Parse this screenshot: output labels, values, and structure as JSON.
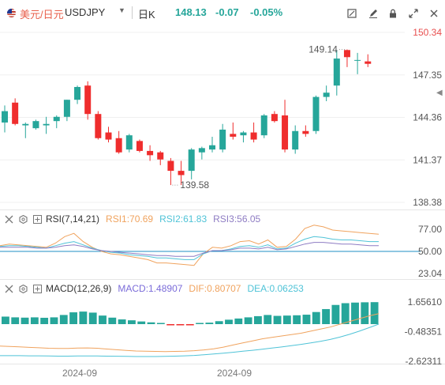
{
  "header": {
    "pair_cn": "美元/日元",
    "pair_code": "USDJPY",
    "period": "日K",
    "price": "148.13",
    "change": "-0.07",
    "change_pct": "-0.05%"
  },
  "toolbar_icons": [
    "draw-icon",
    "pen-icon",
    "lock-icon",
    "fullscreen-icon",
    "close-icon"
  ],
  "colors": {
    "up": "#26a69a",
    "down": "#ef2d2d",
    "rsi1": "#f0a35e",
    "rsi2": "#4fc3d7",
    "rsi3": "#8e7cc3",
    "macd_line": "#f0a35e",
    "signal_line": "#4fc3d7",
    "rsi_ref": "#1f8fc4"
  },
  "chart_data": [
    {
      "type": "candlestick",
      "title": "USDJPY",
      "y_ticks": [
        "150.34",
        "147.35",
        "144.36",
        "141.37",
        "138.38"
      ],
      "ylim": [
        138.38,
        150.34
      ],
      "x_ticks": [
        "2024-09",
        "2024-09"
      ],
      "annotations": {
        "high": "149.14",
        "low": "139.58"
      },
      "candles": [
        {
          "o": 144.0,
          "h": 145.2,
          "l": 143.3,
          "c": 144.8
        },
        {
          "o": 145.4,
          "h": 145.7,
          "l": 143.8,
          "c": 143.9
        },
        {
          "o": 143.8,
          "h": 144.0,
          "l": 142.9,
          "c": 143.9
        },
        {
          "o": 143.6,
          "h": 144.2,
          "l": 143.5,
          "c": 144.1
        },
        {
          "o": 143.8,
          "h": 144.4,
          "l": 143.2,
          "c": 143.9
        },
        {
          "o": 144.1,
          "h": 144.5,
          "l": 143.6,
          "c": 144.4
        },
        {
          "o": 144.4,
          "h": 145.6,
          "l": 144.1,
          "c": 145.6
        },
        {
          "o": 145.6,
          "h": 146.6,
          "l": 145.3,
          "c": 146.5
        },
        {
          "o": 146.6,
          "h": 146.9,
          "l": 144.2,
          "c": 144.6
        },
        {
          "o": 144.6,
          "h": 144.8,
          "l": 142.8,
          "c": 142.9
        },
        {
          "o": 143.3,
          "h": 143.7,
          "l": 142.6,
          "c": 142.8
        },
        {
          "o": 142.9,
          "h": 143.4,
          "l": 141.8,
          "c": 141.9
        },
        {
          "o": 142.1,
          "h": 143.2,
          "l": 141.9,
          "c": 143.1
        },
        {
          "o": 142.7,
          "h": 142.8,
          "l": 141.9,
          "c": 142.0
        },
        {
          "o": 142.0,
          "h": 142.4,
          "l": 141.3,
          "c": 141.7
        },
        {
          "o": 141.9,
          "h": 142.0,
          "l": 141.0,
          "c": 141.4
        },
        {
          "o": 141.3,
          "h": 141.5,
          "l": 139.6,
          "c": 140.6
        },
        {
          "o": 140.6,
          "h": 141.3,
          "l": 139.6,
          "c": 140.3
        },
        {
          "o": 140.6,
          "h": 142.2,
          "l": 140.0,
          "c": 142.1
        },
        {
          "o": 141.9,
          "h": 142.3,
          "l": 141.4,
          "c": 142.2
        },
        {
          "o": 142.1,
          "h": 143.0,
          "l": 141.9,
          "c": 142.4
        },
        {
          "o": 142.1,
          "h": 143.9,
          "l": 141.9,
          "c": 143.5
        },
        {
          "o": 143.2,
          "h": 144.0,
          "l": 142.8,
          "c": 143.0
        },
        {
          "o": 143.1,
          "h": 143.4,
          "l": 142.6,
          "c": 143.3
        },
        {
          "o": 143.3,
          "h": 144.0,
          "l": 142.6,
          "c": 142.8
        },
        {
          "o": 143.1,
          "h": 144.6,
          "l": 142.9,
          "c": 144.5
        },
        {
          "o": 144.6,
          "h": 144.8,
          "l": 144.0,
          "c": 144.1
        },
        {
          "o": 144.5,
          "h": 145.6,
          "l": 141.9,
          "c": 142.1
        },
        {
          "o": 142.1,
          "h": 143.8,
          "l": 141.8,
          "c": 143.4
        },
        {
          "o": 143.4,
          "h": 143.8,
          "l": 143.0,
          "c": 143.2
        },
        {
          "o": 143.4,
          "h": 145.9,
          "l": 143.2,
          "c": 145.8
        },
        {
          "o": 145.8,
          "h": 146.6,
          "l": 145.5,
          "c": 146.1
        },
        {
          "o": 146.6,
          "h": 149.1,
          "l": 145.9,
          "c": 148.5
        },
        {
          "o": 149.1,
          "h": 149.14,
          "l": 147.9,
          "c": 148.6
        },
        {
          "o": 148.4,
          "h": 148.9,
          "l": 147.4,
          "c": 148.4
        },
        {
          "o": 148.3,
          "h": 148.8,
          "l": 147.9,
          "c": 148.13
        }
      ]
    },
    {
      "type": "line",
      "title": "RSI(7,14,21)",
      "y_ticks": [
        "77.00",
        "50.00",
        "23.04"
      ],
      "ref_line": 50,
      "ylim": [
        23.04,
        77.0
      ],
      "series": [
        {
          "name": "RSI1:70.69",
          "values": [
            57,
            59,
            58,
            57,
            56,
            55,
            60,
            68,
            72,
            62,
            55,
            50,
            47,
            46,
            44,
            42,
            40,
            36,
            36,
            35,
            34,
            33,
            47,
            55,
            54,
            57,
            62,
            63,
            59,
            64,
            55,
            56,
            65,
            78,
            82,
            80,
            76,
            75,
            74,
            73,
            72,
            71
          ]
        },
        {
          "name": "RSI2:61.83",
          "values": [
            56,
            57,
            57,
            56,
            55,
            54,
            57,
            60,
            62,
            58,
            54,
            51,
            49,
            48,
            46,
            45,
            44,
            42,
            42,
            41,
            40,
            40,
            47,
            51,
            51,
            53,
            56,
            57,
            55,
            58,
            53,
            54,
            60,
            65,
            68,
            67,
            65,
            64,
            64,
            63,
            62,
            62
          ]
        },
        {
          "name": "RSI3:56.05",
          "values": [
            55,
            55,
            55,
            55,
            54,
            54,
            55,
            57,
            58,
            56,
            53,
            51,
            50,
            49,
            48,
            47,
            46,
            45,
            45,
            44,
            44,
            44,
            48,
            51,
            51,
            52,
            54,
            54,
            53,
            55,
            52,
            53,
            56,
            59,
            61,
            61,
            60,
            59,
            59,
            58,
            57,
            57
          ]
        }
      ]
    },
    {
      "type": "bar",
      "title": "MACD(12,26,9)",
      "y_ticks": [
        "1.65610",
        "-0.48351",
        "-2.62311"
      ],
      "ylim": [
        -2.62311,
        1.6561
      ],
      "series": [
        {
          "name": "MACD:1.48907",
          "values": [
            0.51,
            0.46,
            0.44,
            0.46,
            0.43,
            0.46,
            0.62,
            0.8,
            0.85,
            0.78,
            0.58,
            0.44,
            0.32,
            0.26,
            0.18,
            0.12,
            0.06,
            -0.06,
            -0.08,
            -0.02,
            0.04,
            0.1,
            0.2,
            0.3,
            0.38,
            0.46,
            0.54,
            0.62,
            0.56,
            0.58,
            0.6,
            0.64,
            0.82,
            1.02,
            1.3,
            1.42,
            1.46,
            1.48,
            1.49
          ]
        },
        {
          "name": "DIF:0.80707",
          "values": [
            -1.52,
            -1.55,
            -1.58,
            -1.62,
            -1.65,
            -1.68,
            -1.7,
            -1.7,
            -1.67,
            -1.66,
            -1.68,
            -1.74,
            -1.79,
            -1.84,
            -1.88,
            -1.9,
            -1.91,
            -1.92,
            -1.91,
            -1.9,
            -1.86,
            -1.8,
            -1.72,
            -1.6,
            -1.45,
            -1.3,
            -1.15,
            -1.0,
            -0.9,
            -0.8,
            -0.7,
            -0.6,
            -0.45,
            -0.3,
            -0.15,
            0.05,
            0.25,
            0.45,
            0.65,
            0.81
          ]
        },
        {
          "name": "DEA:0.06253",
          "values": [
            -2.22,
            -2.22,
            -2.22,
            -2.23,
            -2.23,
            -2.24,
            -2.25,
            -2.25,
            -2.24,
            -2.24,
            -2.24,
            -2.25,
            -2.26,
            -2.27,
            -2.28,
            -2.28,
            -2.28,
            -2.27,
            -2.25,
            -2.23,
            -2.2,
            -2.15,
            -2.1,
            -2.04,
            -1.97,
            -1.9,
            -1.83,
            -1.75,
            -1.67,
            -1.59,
            -1.5,
            -1.4,
            -1.3,
            -1.18,
            -1.05,
            -0.88,
            -0.68,
            -0.45,
            -0.2,
            0.06
          ]
        }
      ]
    }
  ]
}
